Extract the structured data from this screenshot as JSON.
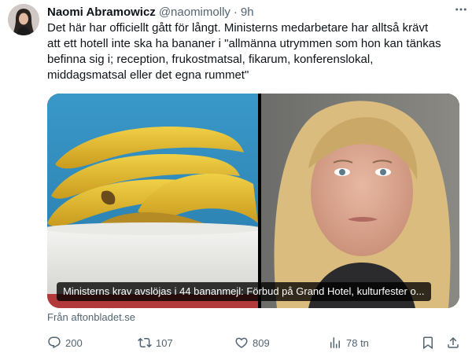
{
  "author": {
    "name": "Naomi Abramowicz",
    "handle": "@naomimolly",
    "time": "9h"
  },
  "tweet": {
    "text": "Det här har officiellt gått för långt. Ministerns medarbetare har alltså krävt\natt ett hotell inte ska ha bananer i \"allmänna utrymmen som hon kan tänkas\nbefinna sig i; reception, frukostmatsal, fikarum, konferenslokal,\nmiddagsmatsal eller det egna rummet\""
  },
  "card": {
    "caption": "Ministerns krav avslöjas i 44 bananmejl: Förbud på Grand Hotel, kulturfester o...",
    "source": "Från aftonbladet.se"
  },
  "stats": {
    "replies": "200",
    "retweets": "107",
    "likes": "809",
    "views": "78 tn"
  },
  "icons": {
    "more": "more-dots-icon",
    "reply": "reply-icon",
    "retweet": "retweet-icon",
    "like": "heart-icon",
    "views": "views-bar-chart-icon",
    "bookmark": "bookmark-icon",
    "share": "share-icon"
  },
  "colors": {
    "text": "#0f1419",
    "secondary": "#536471",
    "background": "#ffffff"
  }
}
